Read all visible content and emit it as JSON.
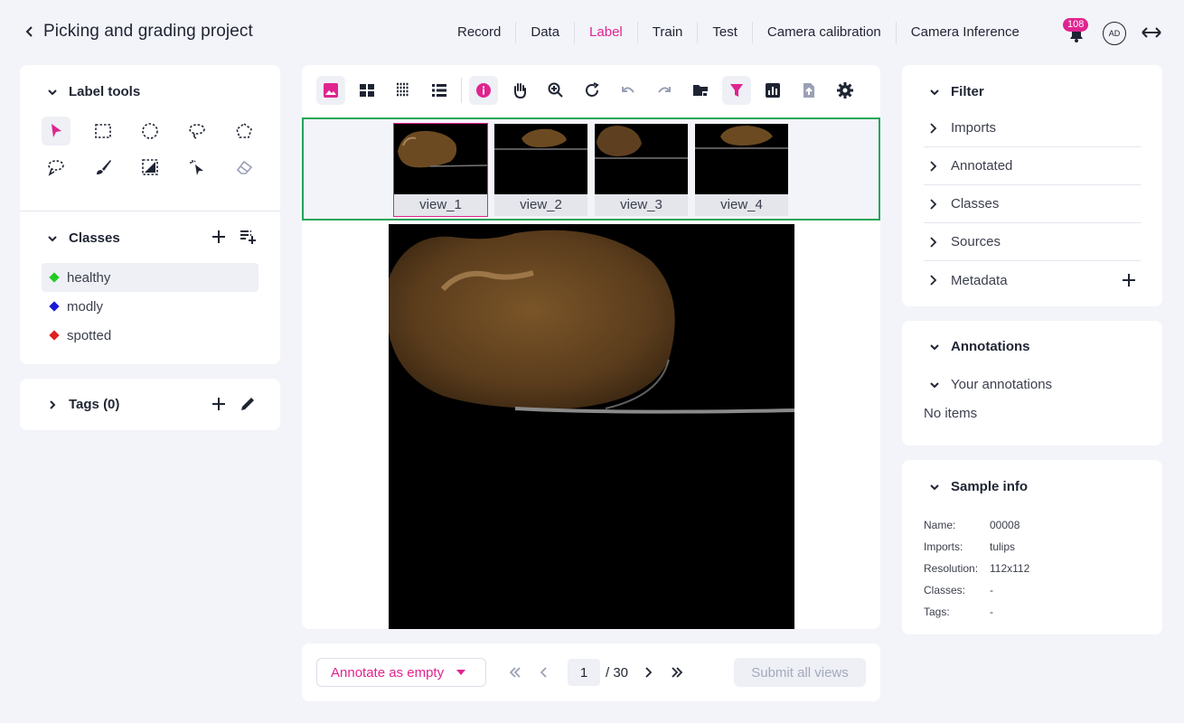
{
  "header": {
    "project_title": "Picking and grading project",
    "nav": [
      {
        "label": "Record",
        "active": false
      },
      {
        "label": "Data",
        "active": false
      },
      {
        "label": "Label",
        "active": true
      },
      {
        "label": "Train",
        "active": false
      },
      {
        "label": "Test",
        "active": false
      },
      {
        "label": "Camera calibration",
        "active": false
      },
      {
        "label": "Camera Inference",
        "active": false
      }
    ],
    "notifications": "108",
    "avatar_initials": "AD",
    "accent_color": "#e0248f"
  },
  "label_tools": {
    "title": "Label tools",
    "tools": [
      "pointer-icon",
      "rectangle-select-icon",
      "ellipse-select-icon",
      "lasso-icon",
      "polygon-icon",
      "freehand-lasso-icon",
      "brush-icon",
      "mask-icon",
      "magic-click-icon",
      "eraser-icon"
    ]
  },
  "classes": {
    "title": "Classes",
    "items": [
      {
        "label": "healthy",
        "color": "#22cc22",
        "selected": true
      },
      {
        "label": "modly",
        "color": "#1a1ad6",
        "selected": false
      },
      {
        "label": "spotted",
        "color": "#e02020",
        "selected": false
      }
    ]
  },
  "tags": {
    "title": "Tags (0)"
  },
  "thumbnails": [
    {
      "label": "view_1",
      "selected": true
    },
    {
      "label": "view_2",
      "selected": false
    },
    {
      "label": "view_3",
      "selected": false
    },
    {
      "label": "view_4",
      "selected": false
    }
  ],
  "bottom": {
    "annotate_label": "Annotate as empty",
    "page_value": "1",
    "page_total": "/ 30",
    "submit_label": "Submit all views"
  },
  "filter": {
    "title": "Filter",
    "items": [
      "Imports",
      "Annotated",
      "Classes",
      "Sources",
      "Metadata"
    ]
  },
  "annotations": {
    "title": "Annotations",
    "your_annotations": "Your annotations",
    "empty": "No items"
  },
  "sample_info": {
    "title": "Sample info",
    "rows": [
      {
        "key": "Name:",
        "value": "00008"
      },
      {
        "key": "Imports:",
        "value": "tulips"
      },
      {
        "key": "Resolution:",
        "value": "112x112"
      },
      {
        "key": "Classes:",
        "value": "-"
      },
      {
        "key": "Tags:",
        "value": "-"
      }
    ]
  }
}
